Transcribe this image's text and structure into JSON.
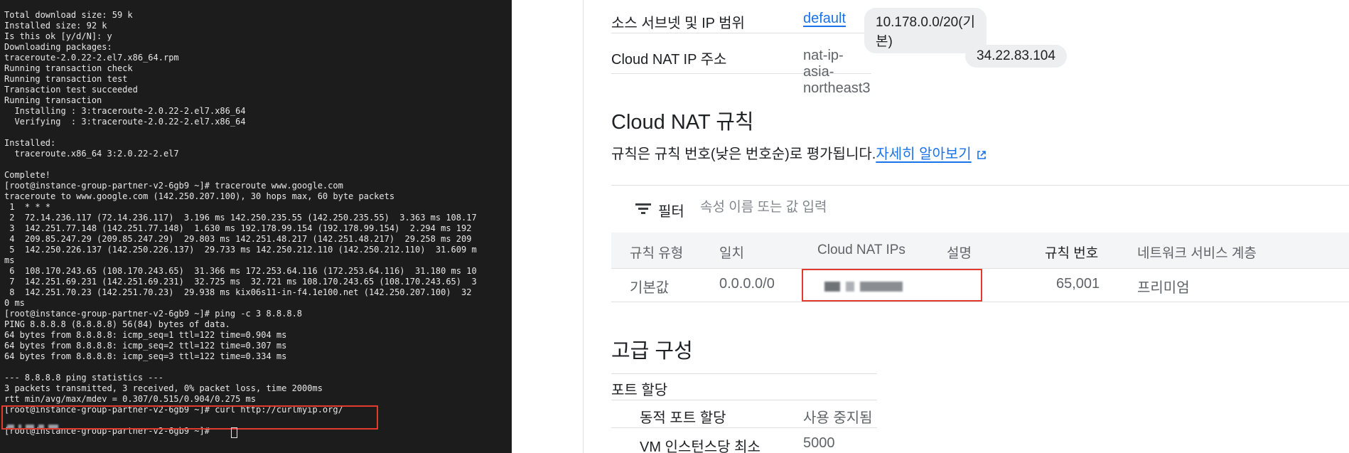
{
  "terminal": {
    "lines": [
      "Total download size: 59 k",
      "Installed size: 92 k",
      "Is this ok [y/d/N]: y",
      "Downloading packages:",
      "traceroute-2.0.22-2.el7.x86_64.rpm",
      "Running transaction check",
      "Running transaction test",
      "Transaction test succeeded",
      "Running transaction",
      "  Installing : 3:traceroute-2.0.22-2.el7.x86_64",
      "  Verifying  : 3:traceroute-2.0.22-2.el7.x86_64",
      "",
      "Installed:",
      "  traceroute.x86_64 3:2.0.22-2.el7",
      "",
      "Complete!",
      "[root@instance-group-partner-v2-6gb9 ~]# traceroute www.google.com",
      "traceroute to www.google.com (142.250.207.100), 30 hops max, 60 byte packets",
      " 1  * * *",
      " 2  72.14.236.117 (72.14.236.117)  3.196 ms 142.250.235.55 (142.250.235.55)  3.363 ms 108.17",
      " 3  142.251.77.148 (142.251.77.148)  1.630 ms 192.178.99.154 (192.178.99.154)  2.294 ms 192",
      " 4  209.85.247.29 (209.85.247.29)  29.803 ms 142.251.48.217 (142.251.48.217)  29.258 ms 209",
      " 5  142.250.226.137 (142.250.226.137)  29.733 ms 142.250.212.110 (142.250.212.110)  31.609 m",
      "ms",
      " 6  108.170.243.65 (108.170.243.65)  31.366 ms 172.253.64.116 (172.253.64.116)  31.180 ms 10",
      " 7  142.251.69.231 (142.251.69.231)  32.725 ms  32.721 ms 108.170.243.65 (108.170.243.65)  3",
      " 8  142.251.70.23 (142.251.70.23)  29.938 ms kix06s11-in-f4.1e100.net (142.250.207.100)  32",
      "0 ms",
      "[root@instance-group-partner-v2-6gb9 ~]# ping -c 3 8.8.8.8",
      "PING 8.8.8.8 (8.8.8.8) 56(84) bytes of data.",
      "64 bytes from 8.8.8.8: icmp_seq=1 ttl=122 time=0.904 ms",
      "64 bytes from 8.8.8.8: icmp_seq=2 ttl=122 time=0.307 ms",
      "64 bytes from 8.8.8.8: icmp_seq=3 ttl=122 time=0.334 ms",
      "",
      "--- 8.8.8.8 ping statistics ---",
      "3 packets transmitted, 3 received, 0% packet loss, time 2000ms",
      "rtt min/avg/max/mdev = 0.307/0.515/0.904/0.275 ms",
      "[root@instance-group-partner-v2-6gb9 ~]# curl http://curlmyip.org/",
      "",
      "[root@instance-group-partner-v2-6gb9 ~]# "
    ]
  },
  "console": {
    "source_subnet": {
      "label": "소스 서브넷 및 IP 범위",
      "link": "default",
      "chip": "10.178.0.0/20(기본)"
    },
    "nat_ip": {
      "label": "Cloud NAT IP 주소",
      "value": "nat-ip-asia-northeast3",
      "chip": "34.22.83.104"
    },
    "rules_section": {
      "title": "Cloud NAT 규칙",
      "description": "규칙은 규칙 번호(낮은 번호순)로 평가됩니다.",
      "learn_more": "자세히 알아보기"
    },
    "filter": {
      "label": "필터",
      "placeholder": "속성 이름 또는 값 입력"
    },
    "table": {
      "headers": [
        "규칙 유형",
        "일치",
        "Cloud NAT IPs",
        "설명",
        "규칙 번호",
        "네트워크 서비스 계층"
      ],
      "row": {
        "rule_type": "기본값",
        "match": "0.0.0.0/0",
        "description": "",
        "rule_number": "65,001",
        "tier": "프리미엄"
      }
    },
    "advanced": {
      "title": "고급 구성",
      "port_allocation": "포트 할당",
      "dynamic_port_label": "동적 포트 할당",
      "dynamic_port_value": "사용 중지됨",
      "min_ports_label": "VM 인스턴스당 최소",
      "min_ports_value": "5000"
    }
  },
  "colors": {
    "accent": "#1a73e8",
    "highlight": "#e23a2e",
    "terminal_bg": "#1c1c1c"
  }
}
